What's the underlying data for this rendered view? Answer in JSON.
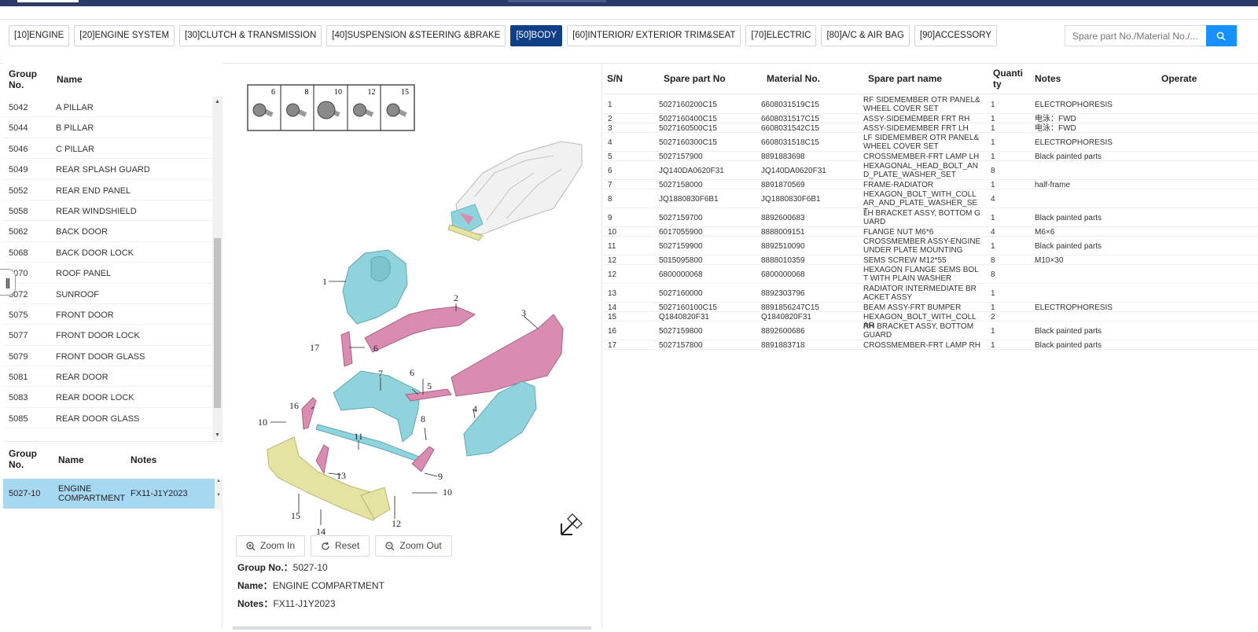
{
  "categories": [
    {
      "label": "[10]ENGINE",
      "active": false
    },
    {
      "label": "[20]ENGINE SYSTEM",
      "active": false
    },
    {
      "label": "[30]CLUTCH & TRANSMISSION",
      "active": false
    },
    {
      "label": "[40]SUSPENSION &STEERING &BRAKE",
      "active": false
    },
    {
      "label": "[50]BODY",
      "active": true
    },
    {
      "label": "[60]INTERIOR/ EXTERIOR TRIM&SEAT",
      "active": false
    },
    {
      "label": "[70]ELECTRIC",
      "active": false
    },
    {
      "label": "[80]A/C & AIR BAG",
      "active": false
    },
    {
      "label": "[90]ACCESSORY",
      "active": false
    }
  ],
  "search": {
    "placeholder": "Spare part No./Material No./...",
    "icon": "search-icon"
  },
  "groups_table": {
    "col_group": "Group No.",
    "col_name": "Name",
    "rows": [
      {
        "no": "5042",
        "name": "A PILLAR"
      },
      {
        "no": "5044",
        "name": "B PILLAR"
      },
      {
        "no": "5046",
        "name": "C PILLAR"
      },
      {
        "no": "5049",
        "name": "REAR SPLASH GUARD"
      },
      {
        "no": "5052",
        "name": "REAR END PANEL"
      },
      {
        "no": "5058",
        "name": "REAR WINDSHIELD"
      },
      {
        "no": "5062",
        "name": "BACK DOOR"
      },
      {
        "no": "5068",
        "name": "BACK DOOR LOCK"
      },
      {
        "no": "5070",
        "name": "ROOF PANEL"
      },
      {
        "no": "5072",
        "name": "SUNROOF"
      },
      {
        "no": "5075",
        "name": "FRONT DOOR"
      },
      {
        "no": "5077",
        "name": "FRONT DOOR LOCK"
      },
      {
        "no": "5079",
        "name": "FRONT DOOR GLASS"
      },
      {
        "no": "5081",
        "name": "REAR DOOR"
      },
      {
        "no": "5083",
        "name": "REAR DOOR LOCK"
      },
      {
        "no": "5085",
        "name": "REAR DOOR GLASS"
      }
    ]
  },
  "sub_table": {
    "col_group": "Group No.",
    "col_name": "Name",
    "col_notes": "Notes",
    "selected": {
      "no": "5027-10",
      "name": "ENGINE COMPARTMENT",
      "notes": "FX11-J1Y2023"
    }
  },
  "diagram": {
    "fasteners": [
      "6",
      "8",
      "10",
      "12",
      "15"
    ],
    "callouts": [
      "1",
      "2",
      "3",
      "4",
      "5",
      "6",
      "6",
      "7",
      "8",
      "9",
      "10",
      "10",
      "11",
      "12",
      "13",
      "14",
      "15",
      "16",
      "17"
    ],
    "colors": {
      "cyan": "#8fd3dc",
      "pink": "#d98bb0",
      "yellow": "#e4e3a2",
      "gray": "#d9d9d9"
    }
  },
  "zoom": {
    "zoom_in": "Zoom In",
    "reset": "Reset",
    "zoom_out": "Zoom Out"
  },
  "details": {
    "group_label": "Group No.：",
    "group_value": "5027-10",
    "name_label": "Name：",
    "name_value": "ENGINE COMPARTMENT",
    "notes_label": "Notes：",
    "notes_value": "FX11-J1Y2023"
  },
  "parts_table": {
    "headers": {
      "sn": "S/N",
      "spare_no": "Spare part No",
      "material": "Material No.",
      "name": "Spare part name",
      "qty": "Quantity",
      "notes": "Notes",
      "operate": "Operate"
    },
    "rows": [
      {
        "sn": "1",
        "spare": "5027160200C15",
        "material": "6608031519C15",
        "name": "RF SIDEMEMBER OTR PANEL&WHEEL COVER SET",
        "qty": "1",
        "notes": "ELECTROPHORESIS"
      },
      {
        "sn": "2",
        "spare": "5027160400C15",
        "material": "6608031517C15",
        "name": "ASSY-SIDEMEMBER FRT RH",
        "qty": "1",
        "notes": "电泳：FWD"
      },
      {
        "sn": "3",
        "spare": "5027160500C15",
        "material": "6608031542C15",
        "name": "ASSY-SIDEMEMBER FRT LH",
        "qty": "1",
        "notes": "电泳：FWD"
      },
      {
        "sn": "4",
        "spare": "5027160300C15",
        "material": "6608031518C15",
        "name": "LF SIDEMEMBER OTR PANEL&WHEEL COVER SET",
        "qty": "1",
        "notes": "ELECTROPHORESIS"
      },
      {
        "sn": "5",
        "spare": "5027157900",
        "material": "8891883698",
        "name": "CROSSMEMBER-FRT LAMP LH",
        "qty": "1",
        "notes": "Black painted parts"
      },
      {
        "sn": "6",
        "spare": "JQ140DA0620F31",
        "material": "JQ140DA0620F31",
        "name": "HEXAGONAL_HEAD_BOLT_AND_PLATE_WASHER_SET",
        "qty": "8",
        "notes": ""
      },
      {
        "sn": "7",
        "spare": "5027158000",
        "material": "8891870569",
        "name": "FRAME-RADIATOR",
        "qty": "1",
        "notes": "half-frame"
      },
      {
        "sn": "8",
        "spare": "JQ1880830F6B1",
        "material": "JQ1880830F6B1",
        "name": "HEXAGON_BOLT_WITH_COLLAR_AND_PLATE_WASHER_SET",
        "qty": "4",
        "notes": ""
      },
      {
        "sn": "9",
        "spare": "5027159700",
        "material": "8892600683",
        "name": "LH BRACKET ASSY, BOTTOM GUARD",
        "qty": "1",
        "notes": "Black painted parts"
      },
      {
        "sn": "10",
        "spare": "6017055900",
        "material": "8888009151",
        "name": "FLANGE NUT M6*6",
        "qty": "4",
        "notes": "M6×6"
      },
      {
        "sn": "11",
        "spare": "5027159900",
        "material": "8892510090",
        "name": "CROSSMEMBER ASSY-ENGINE UNDER PLATE MOUNTING",
        "qty": "1",
        "notes": "Black painted parts"
      },
      {
        "sn": "12",
        "spare": "5015095800",
        "material": "8888010359",
        "name": "SEMS SCREW M12*55",
        "qty": "8",
        "notes": "M10×30"
      },
      {
        "sn": "12",
        "spare": "6800000068",
        "material": "6800000068",
        "name": "HEXAGON FLANGE SEMS BOLT WITH PLAIN WASHER",
        "qty": "8",
        "notes": ""
      },
      {
        "sn": "13",
        "spare": "5027160000",
        "material": "8892303796",
        "name": "RADIATOR INTERMEDIATE BRACKET ASSY",
        "qty": "1",
        "notes": ""
      },
      {
        "sn": "14",
        "spare": "5027160100C15",
        "material": "8891856247C15",
        "name": "BEAM ASSY-FRT BUMPER",
        "qty": "1",
        "notes": "ELECTROPHORESIS"
      },
      {
        "sn": "15",
        "spare": "Q1840820F31",
        "material": "Q1840820F31",
        "name": "HEXAGON_BOLT_WITH_COLLAR",
        "qty": "2",
        "notes": ""
      },
      {
        "sn": "16",
        "spare": "5027159800",
        "material": "8892600686",
        "name": "RH BRACKET ASSY, BOTTOM GUARD",
        "qty": "1",
        "notes": "Black painted parts"
      },
      {
        "sn": "17",
        "spare": "5027157800",
        "material": "8891883718",
        "name": "CROSSMEMBER-FRT LAMP RH",
        "qty": "1",
        "notes": "Black painted parts"
      }
    ]
  }
}
